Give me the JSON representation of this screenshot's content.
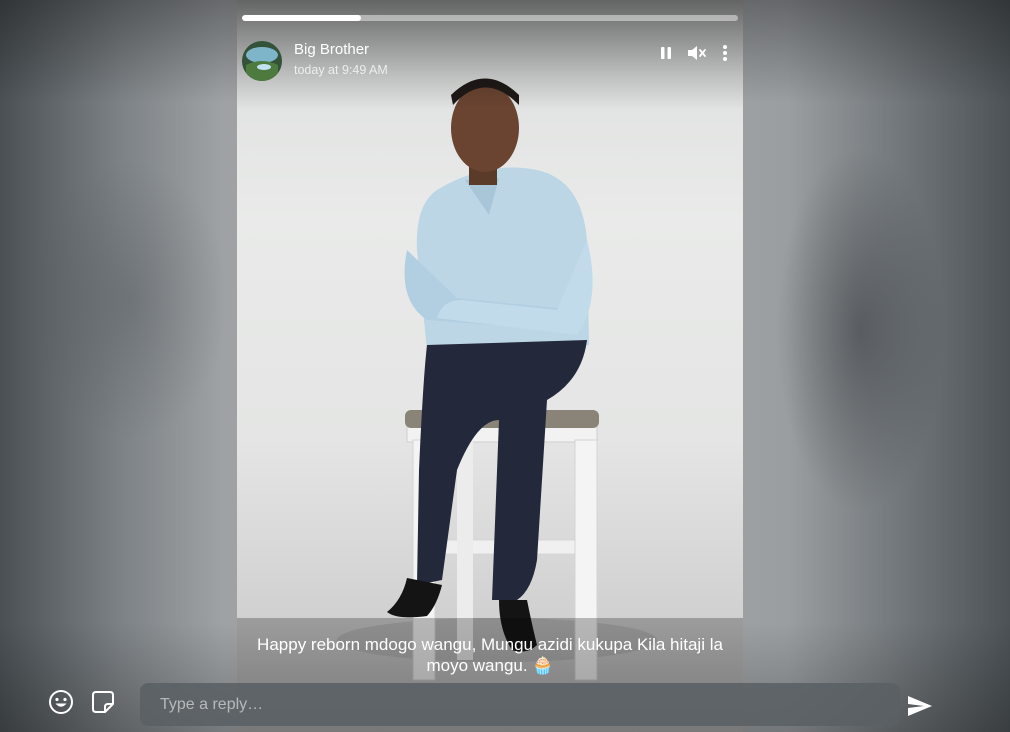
{
  "story": {
    "progress": 0.24,
    "author": {
      "name": "Big Brother",
      "timestamp": "today at 9:49 AM",
      "avatar_icon": "profile-avatar"
    },
    "controls": {
      "pause_icon": "pause-icon",
      "mute_icon": "volume-muted-icon",
      "more_icon": "more-vertical-icon"
    },
    "caption": "Happy reborn mdogo wangu, Mungu azidi kukupa Kila hitaji la moyo wangu. 🧁"
  },
  "reply": {
    "placeholder": "Type a reply…",
    "value": "",
    "emoji_icon": "emoji-icon",
    "sticker_icon": "sticker-icon",
    "send_icon": "send-icon"
  },
  "colors": {
    "progress_fill": "#ffffff",
    "input_bg": "#5a6064"
  }
}
